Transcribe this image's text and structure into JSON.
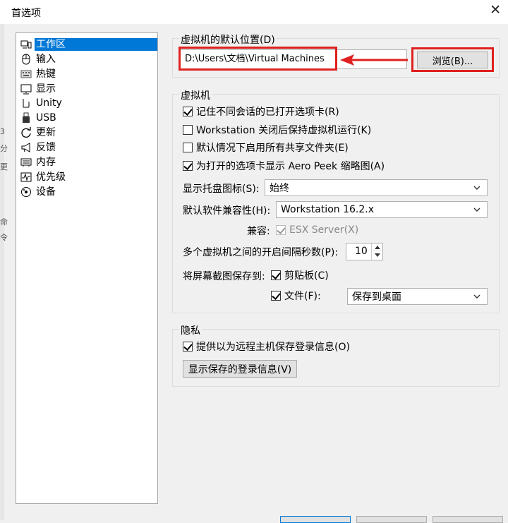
{
  "window": {
    "title": "首选项",
    "close_glyph": "✕"
  },
  "background_glyphs": [
    "3",
    "分",
    "更",
    "命",
    "令"
  ],
  "nav": {
    "items": [
      {
        "label": "工作区",
        "icon": "workspace-icon",
        "selected": true
      },
      {
        "label": "输入",
        "icon": "mouse-icon"
      },
      {
        "label": "热键",
        "icon": "keyboard-icon"
      },
      {
        "label": "显示",
        "icon": "monitor-icon"
      },
      {
        "label": "Unity",
        "icon": "unity-icon"
      },
      {
        "label": "USB",
        "icon": "usb-icon"
      },
      {
        "label": "更新",
        "icon": "refresh-icon"
      },
      {
        "label": "反馈",
        "icon": "megaphone-icon"
      },
      {
        "label": "内存",
        "icon": "memory-icon"
      },
      {
        "label": "优先级",
        "icon": "priority-pulse-icon"
      },
      {
        "label": "设备",
        "icon": "device-icon"
      }
    ]
  },
  "default_location": {
    "group_title": "虚拟机的默认位置(D)",
    "path_value": "D:\\Users\\文档\\Virtual Machines",
    "browse_label": "浏览(B)...",
    "annotation_color": "#e02020"
  },
  "vm": {
    "group_title": "虚拟机",
    "options": [
      {
        "label": "记住不同会话的已打开选项卡(R)",
        "checked": true
      },
      {
        "label": "Workstation 关闭后保持虚拟机运行(K)",
        "checked": false
      },
      {
        "label": "默认情况下启用所有共享文件夹(E)",
        "checked": false
      },
      {
        "label": "为打开的选项卡显示 Aero Peek 缩略图(A)",
        "checked": true
      }
    ],
    "tray_label": "显示托盘图标(S):",
    "tray_value": "始终",
    "compat_label": "默认软件兼容性(H):",
    "compat_value": "Workstation 16.2.x",
    "compatible_label": "兼容:",
    "esx_label": "ESX Server(X)",
    "esx_checked": true,
    "interval_label": "多个虚拟机之间的开启间隔秒数(P):",
    "interval_value": "10",
    "screenshot_label": "将屏幕截图保存到:",
    "clipboard_label": "剪贴板(C)",
    "clipboard_checked": true,
    "file_label": "文件(F):",
    "file_checked": true,
    "file_dest_value": "保存到桌面"
  },
  "privacy": {
    "group_title": "隐私",
    "save_login_label": "提供以为远程主机保存登录信息(O)",
    "save_login_checked": true,
    "show_saved_button": "显示保存的登录信息(V)"
  },
  "colors": {
    "selection": "#0078d7",
    "annotation": "#e02020",
    "window_bg": "#f0f0f0"
  }
}
